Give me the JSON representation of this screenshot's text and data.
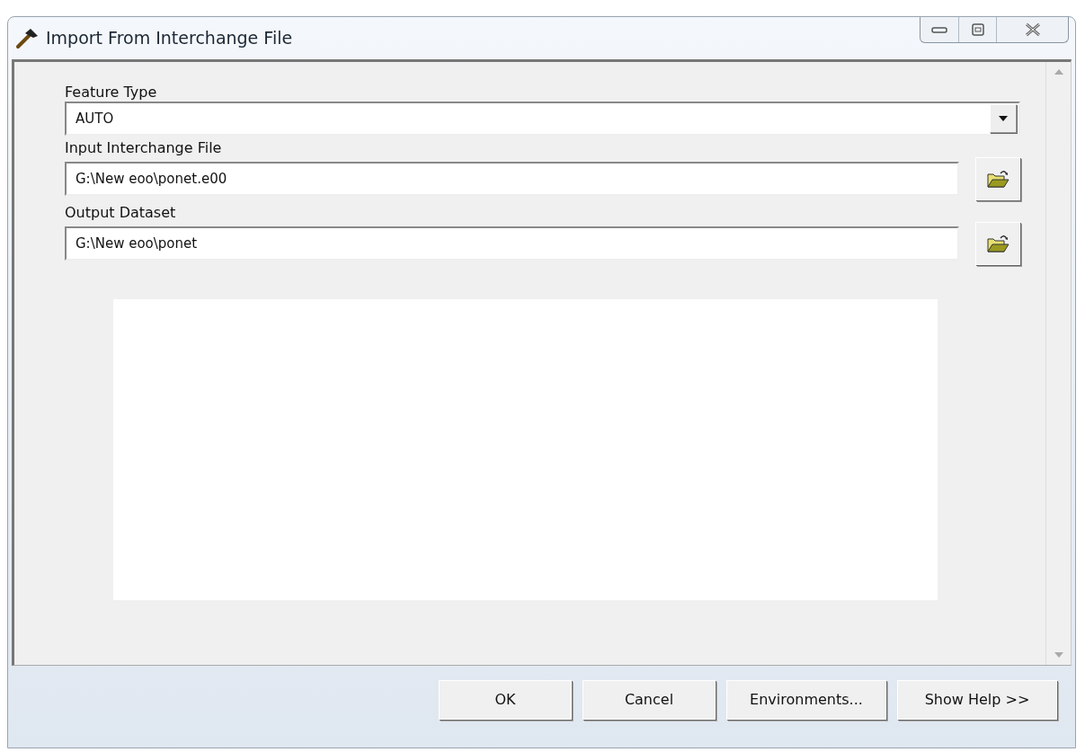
{
  "window": {
    "title": "Import From Interchange File"
  },
  "parameters": [
    {
      "kind": "combo",
      "label": "Feature Type",
      "value": "AUTO"
    },
    {
      "kind": "file",
      "label": "Input Interchange File",
      "value": "G:\\New eoo\\ponet.e00"
    },
    {
      "kind": "file",
      "label": "Output Dataset",
      "value": "G:\\New eoo\\ponet"
    }
  ],
  "buttons": [
    "OK",
    "Cancel",
    "Environments...",
    "Show Help >>"
  ]
}
